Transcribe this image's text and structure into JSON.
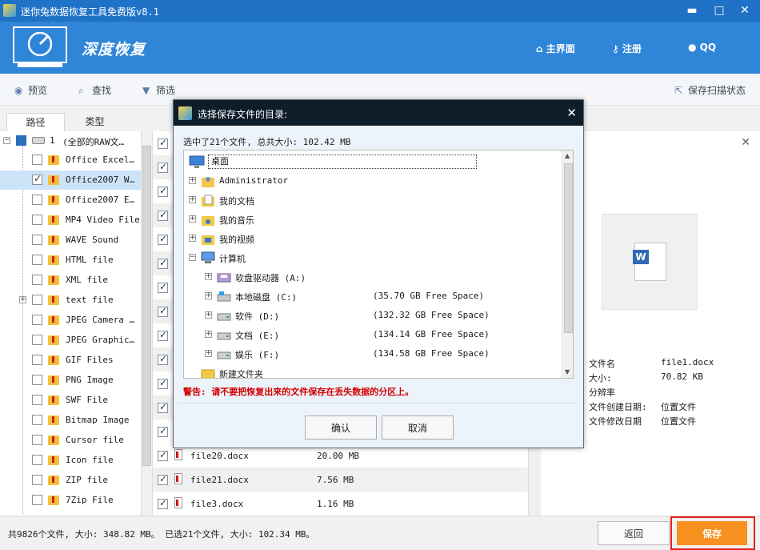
{
  "window": {
    "title": "迷你兔数据恢复工具免费版v8.1",
    "minimize": "▬",
    "maximize": "□",
    "close": "✕"
  },
  "header": {
    "title": "深度恢复",
    "nav": [
      {
        "label": "主界面",
        "icon": "home-icon"
      },
      {
        "label": "注册",
        "icon": "key-icon"
      },
      {
        "label": "QQ",
        "icon": "qq-icon"
      }
    ]
  },
  "toolbar": {
    "preview": "预览",
    "find": "查找",
    "filter": "筛选",
    "save_scan": "保存扫描状态"
  },
  "left_tabs": {
    "path": "路径",
    "type": "类型"
  },
  "tree": {
    "root_number": "1",
    "root_label": "(全部的RAW文…",
    "items": [
      {
        "label": "Office Excel…",
        "checked": false
      },
      {
        "label": "Office2007 W…",
        "checked": true,
        "selected": true
      },
      {
        "label": "Office2007 E…",
        "checked": false
      },
      {
        "label": "MP4 Video File",
        "checked": false
      },
      {
        "label": "WAVE Sound",
        "checked": false
      },
      {
        "label": "HTML file",
        "checked": false
      },
      {
        "label": "XML file",
        "checked": false
      },
      {
        "label": "text file",
        "checked": false,
        "expandable": true
      },
      {
        "label": "JPEG Camera …",
        "checked": false
      },
      {
        "label": "JPEG Graphic…",
        "checked": false
      },
      {
        "label": "GIF Files",
        "checked": false
      },
      {
        "label": "PNG Image",
        "checked": false
      },
      {
        "label": "SWF File",
        "checked": false
      },
      {
        "label": "Bitmap Image",
        "checked": false
      },
      {
        "label": "Cursor file",
        "checked": false
      },
      {
        "label": "Icon file",
        "checked": false
      },
      {
        "label": "ZIP file",
        "checked": false
      },
      {
        "label": "7Zip File",
        "checked": false
      }
    ]
  },
  "files": [
    {
      "name": "file20.docx",
      "size": "20.00 MB",
      "checked": true
    },
    {
      "name": "file21.docx",
      "size": "7.56 MB",
      "checked": true
    },
    {
      "name": "file3.docx",
      "size": "1.16 MB",
      "checked": true
    }
  ],
  "preview": {
    "icon": "word-document-icon",
    "word_letter": "W",
    "close": "✕",
    "fields": [
      {
        "key": "文件名",
        "value": "file1.docx"
      },
      {
        "key": "大小:",
        "value": "70.82 KB"
      },
      {
        "key": "分辨率",
        "value": ""
      },
      {
        "key": "文件创建日期:",
        "value": "位置文件"
      },
      {
        "key": "文件修改日期",
        "value": "位置文件"
      }
    ]
  },
  "status": {
    "text": "共9826个文件, 大小: 348.82 MB。 已选21个文件, 大小: 102.34 MB。",
    "back": "返回",
    "save": "保存"
  },
  "dialog": {
    "title": "选择保存文件的目录:",
    "close": "✕",
    "summary": "选中了21个文件, 总共大小: 102.42 MB",
    "root": "桌面",
    "nodes": [
      {
        "label": "Administrator",
        "icon": "user-folder-icon",
        "free": ""
      },
      {
        "label": "我的文档",
        "icon": "documents-folder-icon",
        "free": ""
      },
      {
        "label": "我的音乐",
        "icon": "music-folder-icon",
        "free": ""
      },
      {
        "label": "我的视频",
        "icon": "video-folder-icon",
        "free": ""
      },
      {
        "label": "计算机",
        "icon": "computer-icon",
        "free": ""
      },
      {
        "label": "软盘驱动器 (A:)",
        "icon": "floppy-drive-icon",
        "free": ""
      },
      {
        "label": "本地磁盘 (C:)",
        "icon": "system-drive-icon",
        "free": "(35.70 GB Free Space)"
      },
      {
        "label": "软件 (D:)",
        "icon": "hard-drive-icon",
        "free": "(132.32 GB Free Space)"
      },
      {
        "label": "文档 (E:)",
        "icon": "hard-drive-icon",
        "free": "(134.14 GB Free Space)"
      },
      {
        "label": "娱乐 (F:)",
        "icon": "hard-drive-icon",
        "free": "(134.58 GB Free Space)"
      },
      {
        "label": "新建文件夹",
        "icon": "folder-icon",
        "free": ""
      }
    ],
    "warning": "警告: 请不要把恢复出来的文件保存在丢失数据的分区上。",
    "ok": "确认",
    "cancel": "取消"
  }
}
